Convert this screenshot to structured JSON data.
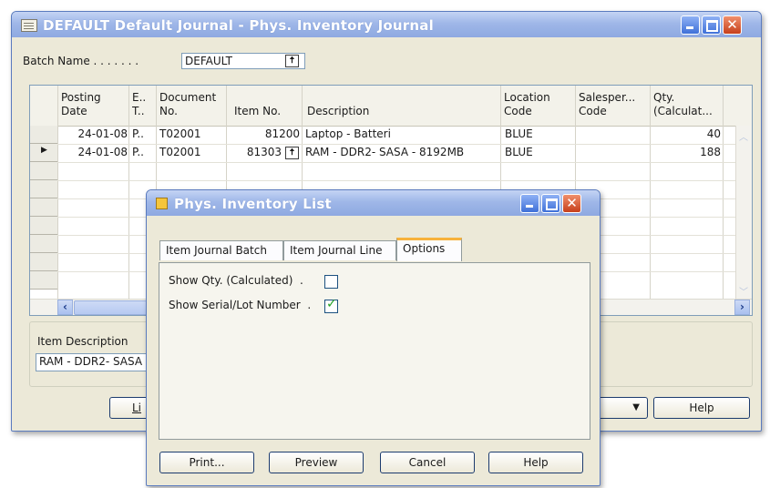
{
  "main_window": {
    "title": "DEFAULT Default Journal - Phys. Inventory Journal",
    "batch_label": "Batch Name . . . . . . .",
    "batch_value": "DEFAULT",
    "columns": [
      "Posting\nDate",
      "E..\nT..",
      "Document\nNo.",
      "Item No.",
      "Description",
      "Location\nCode",
      "Salesper...\nCode",
      "Qty.\n(Calculat..."
    ],
    "rows": [
      {
        "posting_date": "24-01-08",
        "entry_type": "P..",
        "document_no": "T02001",
        "item_no": "81200",
        "description": "Laptop - Batteri",
        "location": "BLUE",
        "salesperson": "",
        "qty": "40",
        "selected": false
      },
      {
        "posting_date": "24-01-08",
        "entry_type": "P..",
        "document_no": "T02001",
        "item_no": "81303",
        "description": "RAM - DDR2- SASA - 8192MB",
        "location": "BLUE",
        "salesperson": "",
        "qty": "188",
        "selected": true
      }
    ],
    "row_pointer": "▶",
    "item_description_label": "Item Description",
    "item_description_value": "RAM - DDR2- SASA",
    "line_button": "Li",
    "help_button": "Help"
  },
  "dialog": {
    "title": "Phys. Inventory List",
    "tabs": [
      "Item Journal Batch",
      "Item Journal Line",
      "Options"
    ],
    "active_tab": "Options",
    "options": [
      {
        "label": "Show Qty. (Calculated)  .",
        "checked": false
      },
      {
        "label": "Show Serial/Lot Number  .",
        "checked": true
      }
    ],
    "buttons": {
      "print": "Print...",
      "preview": "Preview",
      "cancel": "Cancel",
      "help": "Help"
    }
  },
  "icons": {
    "lookup": "lookup-arrow-icon",
    "dropdown": "chevron-down-icon",
    "scroll_left": "scroll-left-icon",
    "scroll_right": "scroll-right-icon"
  },
  "colors": {
    "title_bar": "#9fb7e8",
    "window_face": "#ece9d8",
    "close_button": "#c6401c",
    "active_tab_accent": "#f7b23c",
    "checkmark": "#21a121"
  }
}
